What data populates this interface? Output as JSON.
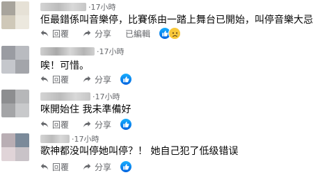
{
  "comments": [
    {
      "time": "17小時",
      "text": "佢最錯係叫音樂停，比賽係由一踏上舞台已開始，叫停音樂大忌",
      "reply_label": "回覆",
      "share_label": "分享",
      "edited_label": "已編輯",
      "reactions": [
        "like",
        "sad"
      ],
      "avatar_colors": [
        "#a8a49c",
        "#e6e1d6",
        "#cfc8b8",
        "#ece8de"
      ]
    },
    {
      "name_partial": "l   l  'i-   Li",
      "time": "17小時",
      "text": "唉！可惜。",
      "reply_label": "回覆",
      "share_label": "分享",
      "reactions": [
        "like"
      ],
      "avatar_colors": [
        "#9a9ca2",
        "#b9bbc0",
        "#c5c7cc",
        "#a3a5aa"
      ]
    },
    {
      "time": "17小時",
      "text": "咪開始住 我未準備好",
      "reply_label": "回覆",
      "share_label": "分享",
      "reactions": [
        "like"
      ],
      "avatar_colors": [
        "#8d8e90",
        "#b6b7b9",
        "#a4a5a7",
        "#c8c9cb"
      ]
    },
    {
      "time": "17小時",
      "text": "歌神都没叫停她叫停？！ 她自己犯了低级错误",
      "reply_label": "回覆",
      "share_label": "分享",
      "reactions": [
        "like"
      ],
      "avatar_colors": [
        "#b9aeb4",
        "#7b8a9a",
        "#e0d4d8",
        "#c9c3c8"
      ]
    }
  ],
  "icons": {
    "reply": "reply-arrow-icon",
    "share": "share-arrow-icon",
    "like": "like-thumb-icon",
    "sad": "sad-face-icon"
  },
  "colors": {
    "meta_text": "#65676b",
    "like_blue": "#0866ff",
    "sad_yellow": "#f8c83a"
  }
}
